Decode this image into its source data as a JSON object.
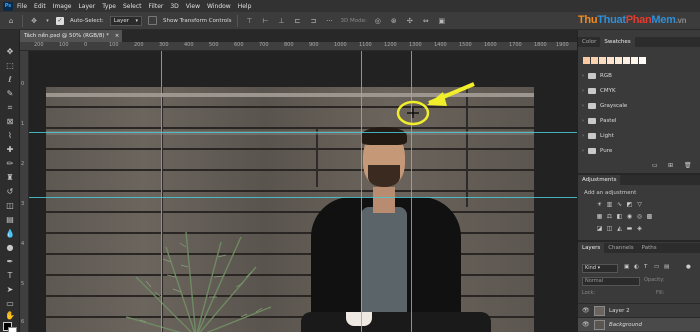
{
  "app": {
    "logo": "Ps"
  },
  "menu": [
    "File",
    "Edit",
    "Image",
    "Layer",
    "Type",
    "Select",
    "Filter",
    "3D",
    "View",
    "Window",
    "Help"
  ],
  "options": {
    "auto_select_label": "Auto-Select:",
    "auto_select_value": "Layer",
    "show_transform_label": "Show Transform Controls",
    "mode_3d_label": "3D Mode:"
  },
  "document_tab": {
    "title": "Tách nền.psd @ 50% (RGB/8) *",
    "close": "×"
  },
  "ruler": {
    "h_labels": [
      "200",
      "100",
      "0",
      "100",
      "200",
      "300",
      "400",
      "500",
      "600",
      "700",
      "800",
      "900",
      "1000",
      "1100",
      "1200",
      "1300",
      "1400",
      "1500",
      "1600",
      "1700",
      "1800",
      "1900"
    ],
    "v_labels": [
      "0",
      "1",
      "2",
      "3",
      "4",
      "5",
      "6"
    ]
  },
  "panels": {
    "color_tab": "Color",
    "swatches_tab": "Swatches",
    "swatch_colors": [
      "#f7c9a5",
      "#f9d3b0",
      "#fbdcbf",
      "#fde5cf",
      "#fdebd9",
      "#fef0e3",
      "#fef5ec",
      "#fefaf5"
    ],
    "swatch_folders": [
      "RGB",
      "CMYK",
      "Grayscale",
      "Pastel",
      "Light",
      "Pure"
    ],
    "adjustments_title": "Adjustments",
    "add_adjustment": "Add an adjustment",
    "layers_tab": "Layers",
    "channels_tab": "Channels",
    "paths_tab": "Paths",
    "kind_filter": "Kind",
    "blend_mode": "Normal",
    "opacity_label": "Opacity:",
    "lock_label": "Lock:",
    "fill_label": "Fill:",
    "layers": [
      "Layer 2",
      "Background"
    ]
  },
  "watermark": "ThuThuatPhanMem.vn"
}
